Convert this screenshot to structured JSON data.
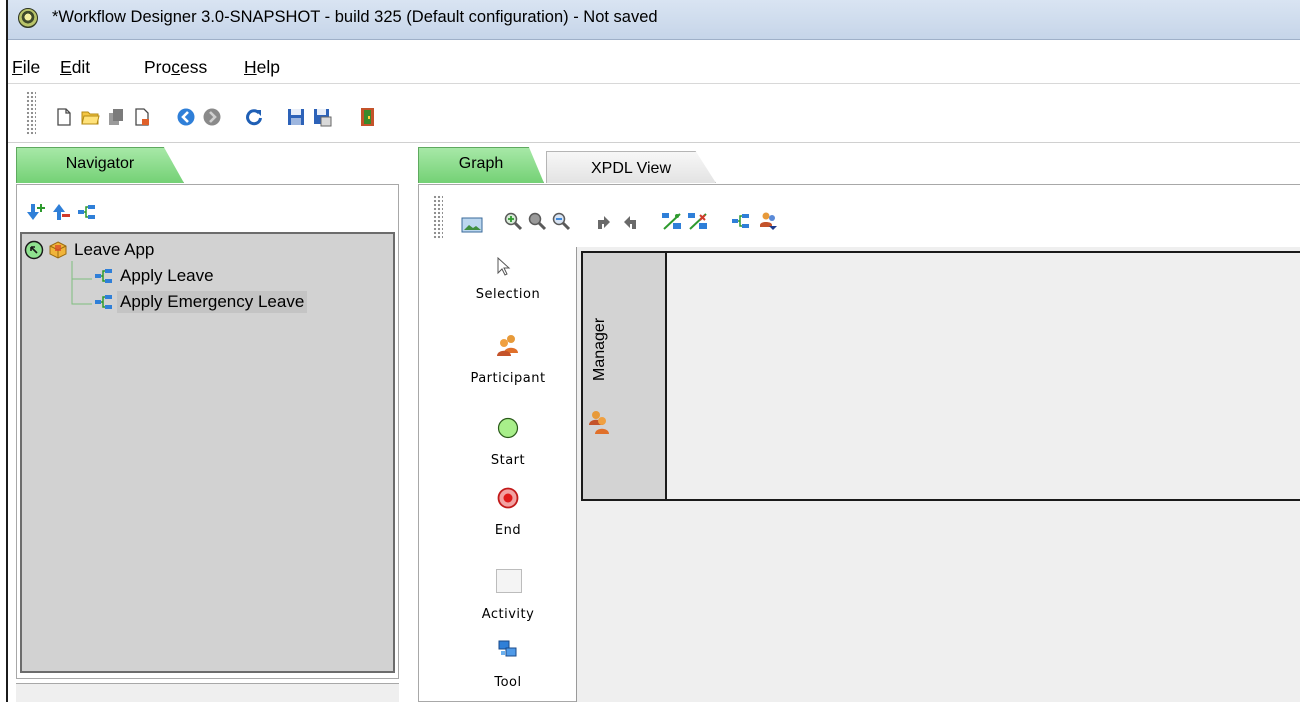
{
  "window": {
    "title": "*Workflow Designer 3.0-SNAPSHOT - build 325 (Default configuration) - Not saved",
    "app_icon": "workflow-designer-logo"
  },
  "menu": [
    {
      "label": "File",
      "mnemonic": "F",
      "rest": "ile"
    },
    {
      "label": "Edit",
      "mnemonic": "E",
      "rest": "dit"
    },
    {
      "label": "Process",
      "pre": "Pro",
      "mnemonic": "c",
      "rest": "ess"
    },
    {
      "label": "Help",
      "mnemonic": "H",
      "rest": "elp"
    }
  ],
  "toolbar": {
    "icons": [
      "new-document-icon",
      "open-folder-icon",
      "save-all-disabled-icon",
      "close-document-icon",
      "back-icon",
      "forward-disabled-icon",
      "refresh-icon",
      "save-icon",
      "save-as-icon",
      "exit-icon"
    ]
  },
  "navigator": {
    "tab_label": "Navigator",
    "tool_icons": [
      "move-down-icon",
      "move-up-icon",
      "process-icon"
    ],
    "tree": {
      "root": "Leave App",
      "children": [
        "Apply Leave",
        "Apply Emergency Leave"
      ],
      "selected": "Apply Emergency Leave"
    }
  },
  "editor": {
    "tabs": [
      "Graph",
      "XPDL View"
    ],
    "active_tab": "Graph",
    "graph_toolbar": [
      "screenshot-icon",
      "zoom-in-icon",
      "actual-size-icon",
      "zoom-out-icon",
      "move-up-participant-icon",
      "move-down-participant-icon",
      "connect-icon",
      "disconnect-icon",
      "subflow-icon",
      "process-icon",
      "add-participant-icon"
    ],
    "palette": [
      "Selection",
      "Participant",
      "Start",
      "End",
      "Activity",
      "Tool"
    ],
    "lane": {
      "participant": "Manager"
    }
  },
  "colors": {
    "active_tab": "#7fd47f",
    "tree_background": "#d2d2d2",
    "canvas_background": "#efefef",
    "lane_header": "#d3d3d3"
  }
}
